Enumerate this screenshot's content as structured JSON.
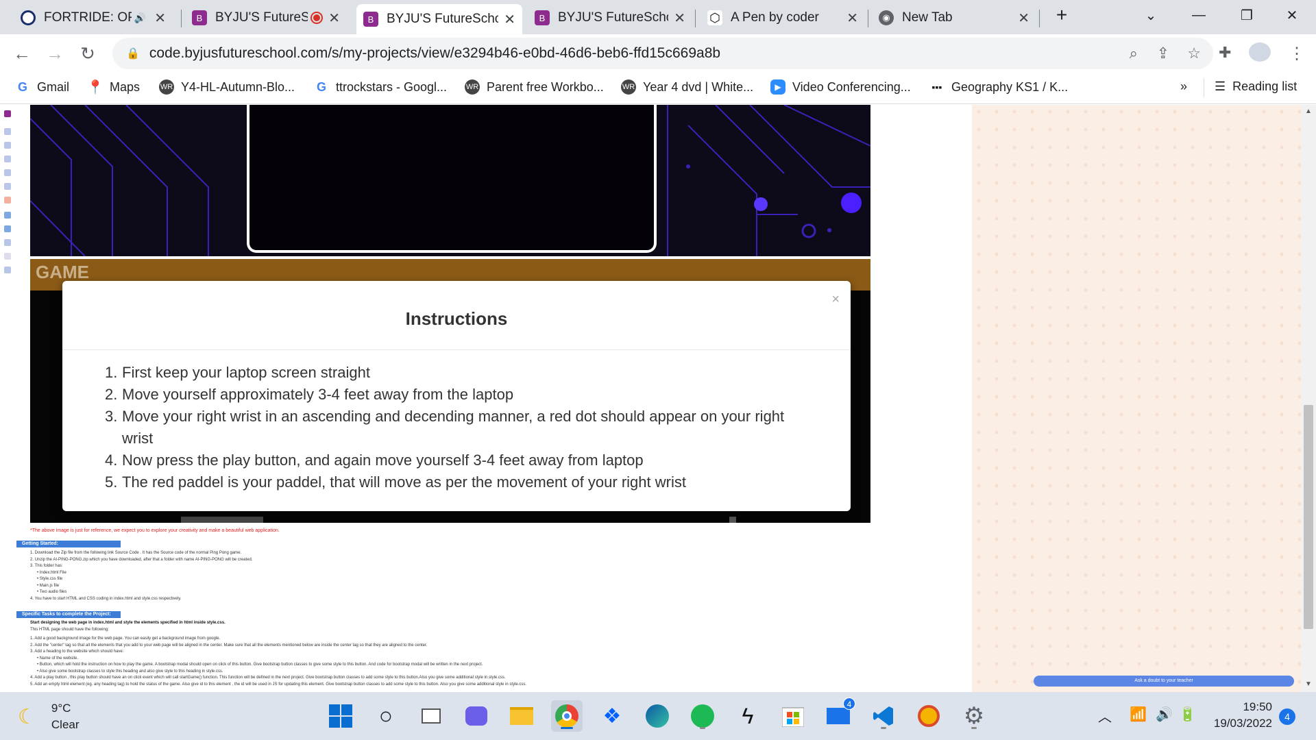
{
  "tabs": [
    {
      "title": "FORTRIDE: OPE",
      "icon": "fortride-icon",
      "active": false,
      "audio": true
    },
    {
      "title": "BYJU'S FutureS",
      "icon": "byjus-icon",
      "active": false,
      "recording": true
    },
    {
      "title": "BYJU'S FutureSchoo",
      "icon": "byjus-icon",
      "active": true
    },
    {
      "title": "BYJU'S FutureSchoo",
      "icon": "byjus-icon",
      "active": false
    },
    {
      "title": "A Pen by coder",
      "icon": "codepen-icon",
      "active": false
    },
    {
      "title": "New Tab",
      "icon": "chrome-icon",
      "active": false
    }
  ],
  "address": {
    "url": "code.byjusfutureschool.com/s/my-projects/view/e3294b46-e0bd-46d6-beb6-ffd15c669a8b"
  },
  "bookmarks": [
    {
      "label": "Gmail",
      "icon": "google-icon"
    },
    {
      "label": "Maps",
      "icon": "maps-icon"
    },
    {
      "label": "Y4-HL-Autumn-Blo...",
      "icon": "whiterose-icon"
    },
    {
      "label": "ttrockstars - Googl...",
      "icon": "google-icon"
    },
    {
      "label": "Parent free Workbo...",
      "icon": "whiterose-icon"
    },
    {
      "label": "Year 4 dvd | White...",
      "icon": "whiterose-icon"
    },
    {
      "label": "Video Conferencing...",
      "icon": "zoom-icon"
    },
    {
      "label": "Geography KS1 / K...",
      "icon": "grid-icon"
    }
  ],
  "reading_list": "Reading list",
  "more_bookmarks": "»",
  "game": {
    "header": "GAME"
  },
  "modal": {
    "title": "Instructions",
    "close": "×",
    "items": [
      "First keep your laptop screen straight",
      "Move yourself approximately 3-4 feet away from the laptop",
      "Move your right wrist in an ascending and decending manner, a red dot should appear on your right wrist",
      "Now press the play button, and again move yourself 3-4 feet away from laptop",
      "The red paddel is your paddel, that will move as per the movement of your right wrist"
    ]
  },
  "page": {
    "note": "*The above image is just for reference, we expect you to explore your creativity and make a beautiful web application.",
    "getting_started": "Getting Started:",
    "getting_started_items": [
      "1. Download the Zip file from the following link Source Code . It has the Source code of the normal Ping Pong game.",
      "2. Unzip the AI-PING-PONG.zip which you have downloaded, after that a folder with name AI-PING-PONG will be created.",
      "3. This folder has:",
      "• Index.html File",
      "• Style.css file",
      "• Main.js file",
      "• Two audio files",
      "4. You have to start HTML and CSS coding in index.html and style.css respectively."
    ],
    "specific_tasks": "Specific Tasks to complete the Project:",
    "tasks_intro": "Start designing the web page in index.html and style the elements specified in html inside style.css.",
    "tasks_intro2": "This HTML page should have the following:",
    "task_items": [
      "1. Add a good background image for the web page. You can easily get a background image from google.",
      "2. Add the \"center\" tag so that all the elements that you add to your web page will be aligned in the center. Make sure that all the elements mentioned below are inside the center tag so that they are aligned to the center.",
      "3. Add a heading to the website which should have:",
      "• Name of the website.",
      "• Button, which will hold the instruction on how to play the game. A bootstrap modal should open on click of this button. Give bootstrap button classes to give some style to this button. And code for bootstrap modal will be written in the next project.",
      "• Also give some bootstrap classes to style this heading and also give style to this heading in style.css.",
      "4. Add a play button , this play button should have an on click event which will call startGame() function. This function will be defined in the next project. Give bootstrap button classes to add some style to this button.Also you give some additional style in style.css.",
      "5. Add an empty html element (eg. any heading tag) to hold the status of the game. Also give id to this element , the id will be used in JS for updating this element. Give bootstrap button classes to add some style to this button. Also you give some additional style in style.css."
    ],
    "ask_doubt": "Ask a doubt to your teacher"
  },
  "taskbar": {
    "weather_temp": "9°C",
    "weather_desc": "Clear",
    "mail_badge": "4",
    "time": "19:50",
    "date": "19/03/2022",
    "notifications": "4"
  }
}
